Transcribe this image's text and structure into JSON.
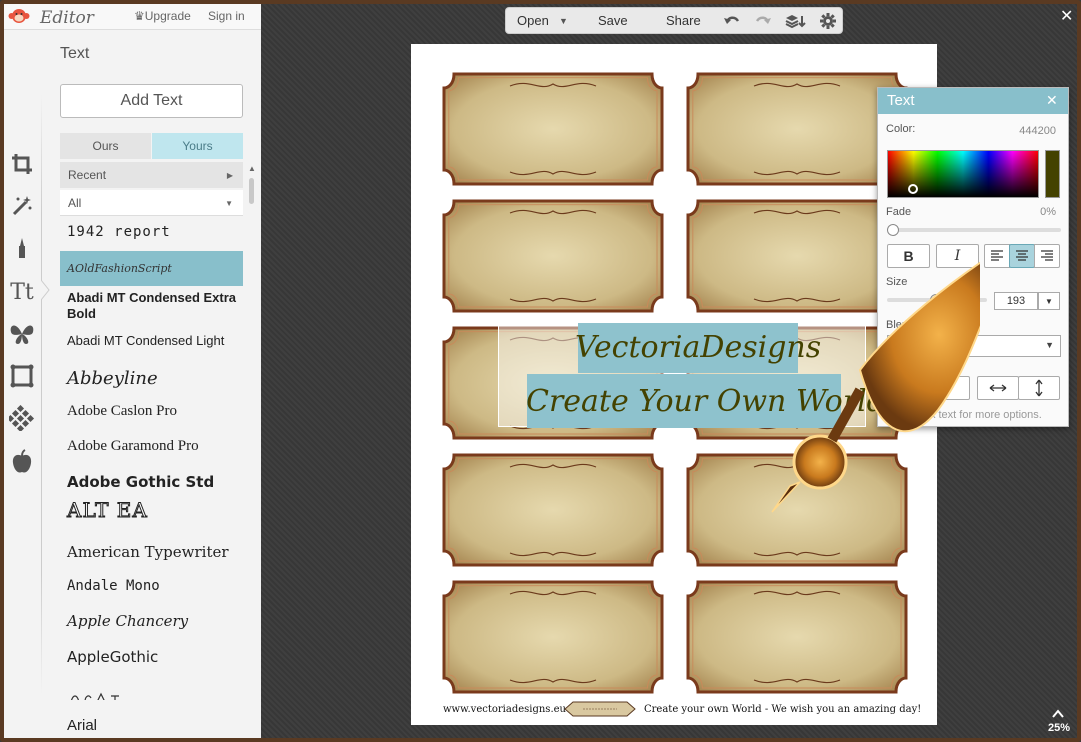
{
  "header": {
    "brand": "Editor",
    "upgrade_label": "Upgrade",
    "signin_label": "Sign in"
  },
  "left_tools": [
    {
      "name": "crop-icon"
    },
    {
      "name": "effects-wand-icon"
    },
    {
      "name": "touch-up-icon"
    },
    {
      "name": "text-tool-icon",
      "glyph": "Tt"
    },
    {
      "name": "overlays-butterfly-icon"
    },
    {
      "name": "frames-icon"
    },
    {
      "name": "textures-icon"
    },
    {
      "name": "theme-apple-icon"
    }
  ],
  "text_panel": {
    "title": "Text",
    "add_text_label": "Add Text",
    "tab_ours": "Ours",
    "tab_yours": "Yours",
    "recent_label": "Recent",
    "filter_label": "All"
  },
  "fonts": [
    {
      "label": "1942 report"
    },
    {
      "label": "AOldFashionScript",
      "selected": true
    },
    {
      "label": "Abadi MT Condensed Extra Bold"
    },
    {
      "label": "Abadi MT Condensed Light"
    },
    {
      "label": "Abbeyline"
    },
    {
      "label": "Adobe Caslon Pro"
    },
    {
      "label": "Adobe Garamond Pro"
    },
    {
      "label": "Adobe Gothic Std"
    },
    {
      "label": "ALT EA"
    },
    {
      "label": "American Typewriter"
    },
    {
      "label": "Andale Mono"
    },
    {
      "label": "Apple Chancery"
    },
    {
      "label": "AppleGothic"
    },
    {
      "label": "Arial"
    }
  ],
  "toolbar": {
    "open_label": "Open",
    "save_label": "Save",
    "share_label": "Share"
  },
  "zoom_level": "25%",
  "canvas": {
    "footer_url": "www.vectoriadesigns.eu",
    "footer_tagline": "Create your own World - We wish you an amazing day!",
    "text_line1": "VectoriaDesigns",
    "text_line2": "Create Your Own World"
  },
  "text_props": {
    "title": "Text",
    "color_label": "Color:",
    "color_value": "444200",
    "color_hex": "#444200",
    "fade_label": "Fade",
    "fade_value": "0%",
    "fade_level": 0,
    "bold_label": "B",
    "italic_label": "I",
    "size_label": "Size",
    "size_value": "193",
    "blend_label": "Blend m",
    "button_partial_label": "te",
    "hint": "ick text for more options."
  },
  "colors": {
    "accent": "#88bfcb",
    "tab_active_bg": "#bfe6ee"
  }
}
